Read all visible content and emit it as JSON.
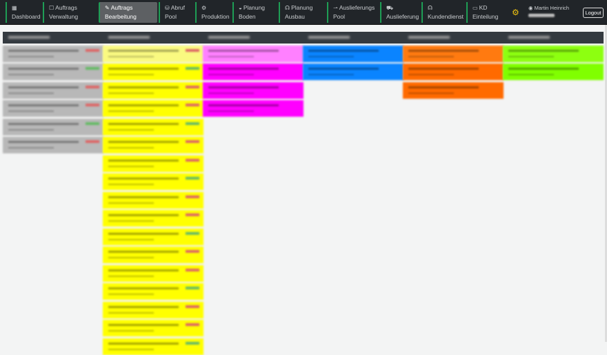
{
  "nav": {
    "items": [
      {
        "icon": "dashboard-icon",
        "glyph": "▦",
        "line1": "",
        "line2": "Dashboard",
        "active": false
      },
      {
        "icon": "edit-square-icon",
        "glyph": "☐",
        "line1": "Auftrags",
        "line2": "Verwaltung",
        "active": false
      },
      {
        "icon": "pencil-square-icon",
        "glyph": "✎",
        "line1": "Auftrags",
        "line2": "Bearbeitung",
        "active": true
      },
      {
        "icon": "database-icon",
        "glyph": "⛁",
        "line1": "Abruf",
        "line2": "Pool",
        "active": false
      },
      {
        "icon": "gear-circle-icon",
        "glyph": "⚙",
        "line1": "",
        "line2": "Produktion",
        "active": false
      },
      {
        "icon": "layers-icon",
        "glyph": "◒",
        "line1": "Planung",
        "line2": "Boden",
        "active": false
      },
      {
        "icon": "headset-icon",
        "glyph": "☊",
        "line1": "Planung",
        "line2": "Ausbau",
        "active": false
      },
      {
        "icon": "arrow-right-icon",
        "glyph": "⇀",
        "line1": "Auslieferungs",
        "line2": "Pool",
        "active": false
      },
      {
        "icon": "truck-icon",
        "glyph": "⛟",
        "line1": "",
        "line2": "Auslieferung",
        "active": false
      },
      {
        "icon": "headphones-icon",
        "glyph": "☊",
        "line1": "",
        "line2": "Kundendienst",
        "active": false
      },
      {
        "icon": "calendar-icon",
        "glyph": "▭",
        "line1": "KD",
        "line2": "Einteilung",
        "active": false
      }
    ],
    "user": "Martin Heinrich",
    "logout": "Logout"
  },
  "columns": [
    {
      "color": "#b8b8b8",
      "first": "#b8b8b8",
      "cards": 6
    },
    {
      "color": "#ffff00",
      "first": "#fafa80",
      "cards": 17
    },
    {
      "color": "#ff00ff",
      "first": "#ff80ff",
      "cards": 4
    },
    {
      "color": "#0a84ff",
      "first": "#0a84ff",
      "cards": 2
    },
    {
      "color": "#ff6a00",
      "first": "#ff7a10",
      "cards": 3
    },
    {
      "color": "#80ff00",
      "first": "#8dff10",
      "cards": 2
    }
  ]
}
